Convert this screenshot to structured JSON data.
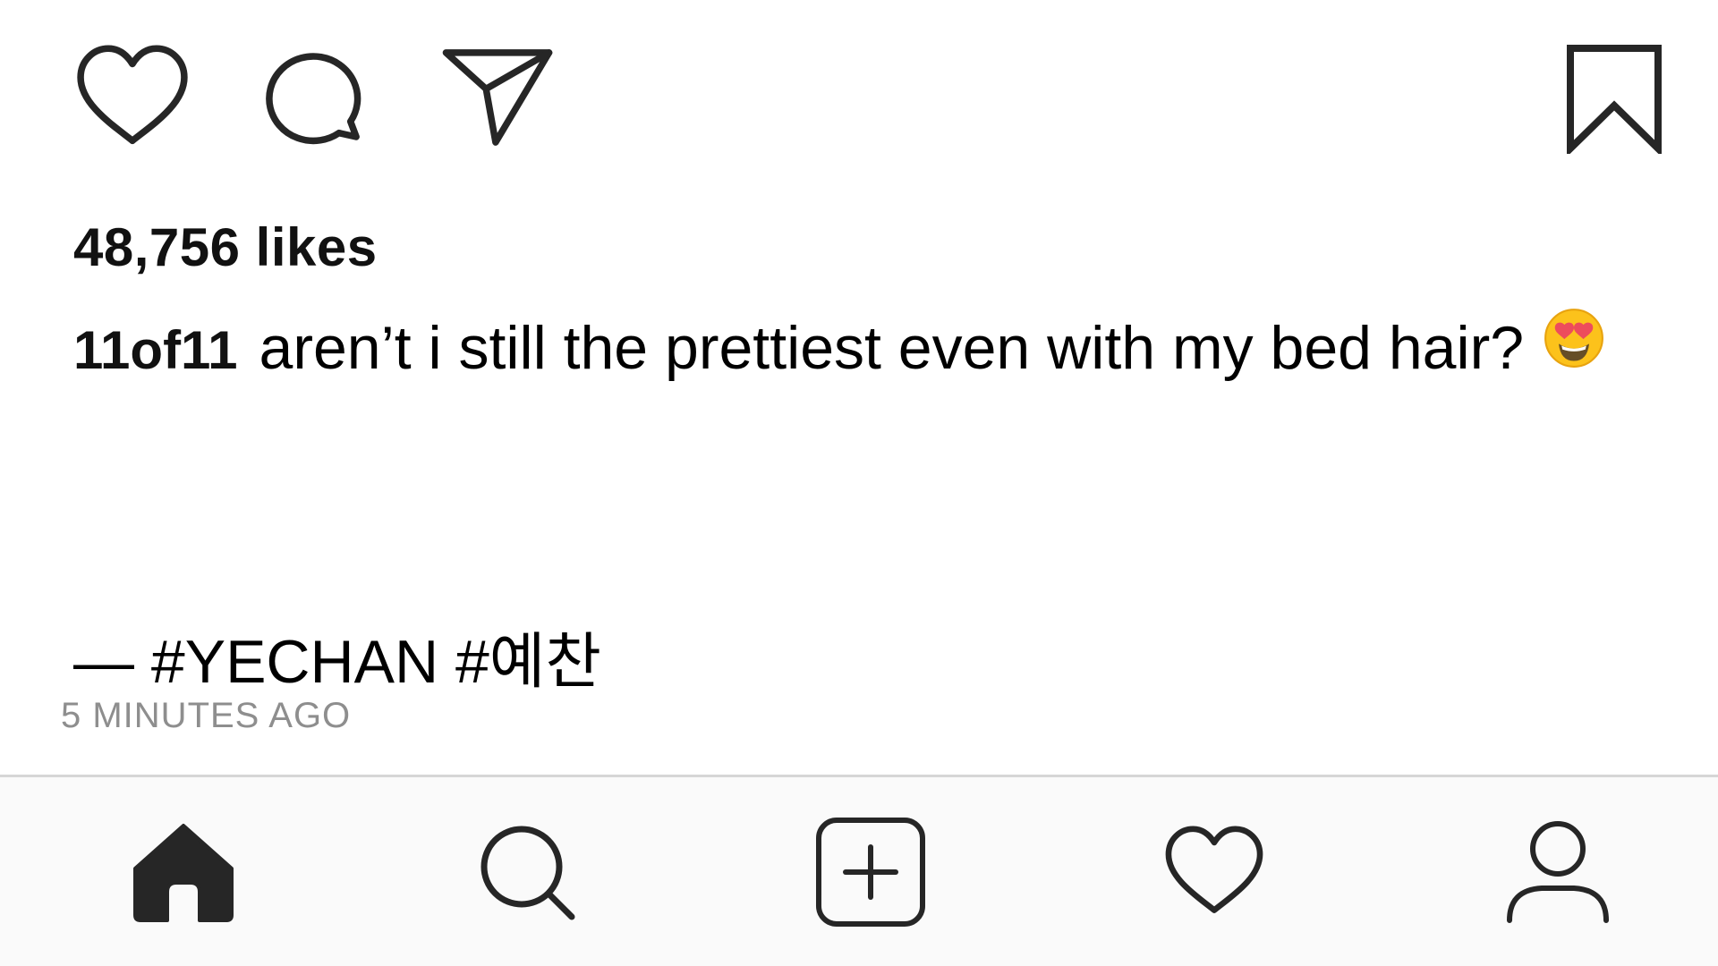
{
  "actions": {
    "like_icon": "heart-outline-icon",
    "comment_icon": "speech-bubble-icon",
    "share_icon": "paper-plane-icon",
    "save_icon": "bookmark-icon"
  },
  "post": {
    "likes": "48,756 likes",
    "username": "11of11",
    "caption": "aren’t i still the prettiest even with my bed hair?",
    "caption_emoji": "heart-eyes-emoji",
    "hashtags": "— #YECHAN #예찬",
    "timestamp": "5 MINUTES AGO"
  },
  "tab_bar": {
    "items": [
      {
        "name": "home",
        "icon": "home-filled-icon",
        "active": true
      },
      {
        "name": "search",
        "icon": "search-icon",
        "active": false
      },
      {
        "name": "new-post",
        "icon": "plus-square-icon",
        "active": false
      },
      {
        "name": "activity",
        "icon": "heart-outline-icon",
        "active": false
      },
      {
        "name": "profile",
        "icon": "person-outline-icon",
        "active": false
      }
    ]
  },
  "colors": {
    "text": "#111111",
    "muted": "#8e8e8e",
    "tab_bar_bg": "#fafafa",
    "divider": "#d6d6d6",
    "icon_stroke": "#262626"
  }
}
